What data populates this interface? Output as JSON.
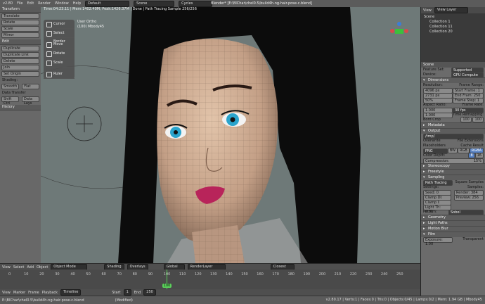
{
  "topbar": {
    "version": "v2.80",
    "menus": [
      "File",
      "Edit",
      "Render",
      "Window",
      "Help"
    ],
    "workspace": "Default",
    "scene": "Scene",
    "engine": "Cycles",
    "window_title": "Blender* [E:\\BlChar\\chel0.5\\build4h-ng-hair-pose-c.blend]"
  },
  "render_info": "Time:04:23.11 | Mem:1402.40M, Peak:1426.37M | Done | Path Tracing Sample 256/256",
  "viewport": {
    "view_name": "User Ortho",
    "object": "(100) Mbody45"
  },
  "tools": [
    "Cursor",
    "Select Border",
    "Move",
    "Rotate",
    "Scale",
    "Ruler"
  ],
  "left": {
    "transform_header": "Transform",
    "transform_buttons": [
      "Translate",
      "Rotate",
      "Scale",
      "Mirror"
    ],
    "edit_header": "Edit",
    "edit_buttons": [
      "Duplicate",
      "Duplicate Link",
      "Delete",
      "Join"
    ],
    "edit_shortcuts": [
      "Shift D",
      "Alt D",
      "",
      "Ctrl J"
    ],
    "set_origin": "Set Origin",
    "shading_label": "Shading:",
    "smooth": "Smooth",
    "flat": "Flat",
    "data_transfer": "Data Transfer",
    "shift_ctrl": "Shift Ctrl",
    "data_lays": "Data Lays",
    "history": "History"
  },
  "right": {
    "view": "View",
    "view_layer": "View Layer",
    "outliner": [
      "Scene",
      "Collection 1",
      "Collection 11",
      "Collection 20"
    ],
    "scene_label": "Scene",
    "feature_set_label": "Feature Set:",
    "feature_set": "Supported",
    "device_label": "Device:",
    "device": "GPU Compute",
    "dimensions": "Dimensions",
    "resolution": "Resolution:",
    "res_x": "4096 px",
    "res_y": "2731 px",
    "res_pct": "50%",
    "frame_range": "Frame Range:",
    "start_frame": "Start Frame: 1",
    "end_frame": "End Fram: 250",
    "frame_step": "Frame Step: 1",
    "aspect": "Aspect Ratio:",
    "asp_x": "1.000",
    "asp_y": "1.000",
    "frame_rate": "Frame Rate:",
    "fps": "30 fps",
    "time_remap": "Time Remapping:",
    "old": "100",
    "new": "100",
    "border": "Bord",
    "crop": "Crop",
    "metadata": "Metadata",
    "output": "Output",
    "output_path": "/tmp/",
    "overwrite": "Overwrite",
    "file_ext": "File Extensions",
    "placeholders": "Placeholders",
    "cache_result": "Cache Result",
    "format": "PNG",
    "bw": "BW",
    "rgb": "RGB",
    "rgba": "RGBA",
    "color_depth": "Color Depth:",
    "depth8": "8",
    "depth16": "16",
    "compression": "Compression:",
    "compression_val": "15%",
    "stereoscopy": "Stereoscopy",
    "freestyle": "Freestyle",
    "sampling": "Sampling",
    "integrator": "Path Tracing",
    "square_samples": "Square Samples",
    "settings": "Settings:",
    "samples": "Samples:",
    "seed": "Seed: 0",
    "render": "Render: 384",
    "clamp_dir": "Clamp Di: 0.00",
    "preview": "Preview: 256",
    "clamp_ind": "Clamp I: 10.00",
    "light_th": "Light Th: 0.01",
    "pattern_label": "Pattern:",
    "pattern": "Sobol",
    "geometry": "Geometry",
    "light_paths": "Light Paths",
    "motion_blur": "Motion Blur",
    "film": "Film",
    "exposure": "Exposure: 1.00",
    "transparent": "Transparent"
  },
  "header3d": {
    "menus": [
      "View",
      "Select",
      "Add",
      "Object"
    ],
    "mode": "Object Mode",
    "shading": "Shading",
    "overlays": "Overlays",
    "orientation": "Global",
    "render_layer": "RenderLayer",
    "snap": "Closest"
  },
  "timeline": {
    "ticks": [
      "0",
      "10",
      "20",
      "30",
      "40",
      "50",
      "60",
      "70",
      "80",
      "90",
      "100",
      "110",
      "120",
      "130",
      "140",
      "150",
      "160",
      "170",
      "180",
      "190",
      "200",
      "210",
      "220",
      "230",
      "240",
      "250"
    ],
    "current_frame": "100",
    "current_value": 100,
    "frame_min": 0,
    "frame_max": 250,
    "menus": [
      "View",
      "Marker",
      "Frame",
      "Playback"
    ],
    "timeline_label": "Timeline",
    "start_label": "Start",
    "start": "1",
    "end_label": "End",
    "end": "250"
  },
  "status": {
    "path": "E:\\BlChar\\chel0.5\\build4h-ng-hair-pose-c.blend",
    "modified": "(Modified)",
    "stats": "v2.80.17 | Verts:1 | Faces:0 | Tris:0 | Objects:0/45 | Lamps:0/2 | Mem: 1.94 GB | Mbody45"
  },
  "colors": {
    "viewport_bg": "#6e7978",
    "skin": "#c8a890",
    "hair": "#0c0c0c",
    "accent": "#5680c2"
  }
}
